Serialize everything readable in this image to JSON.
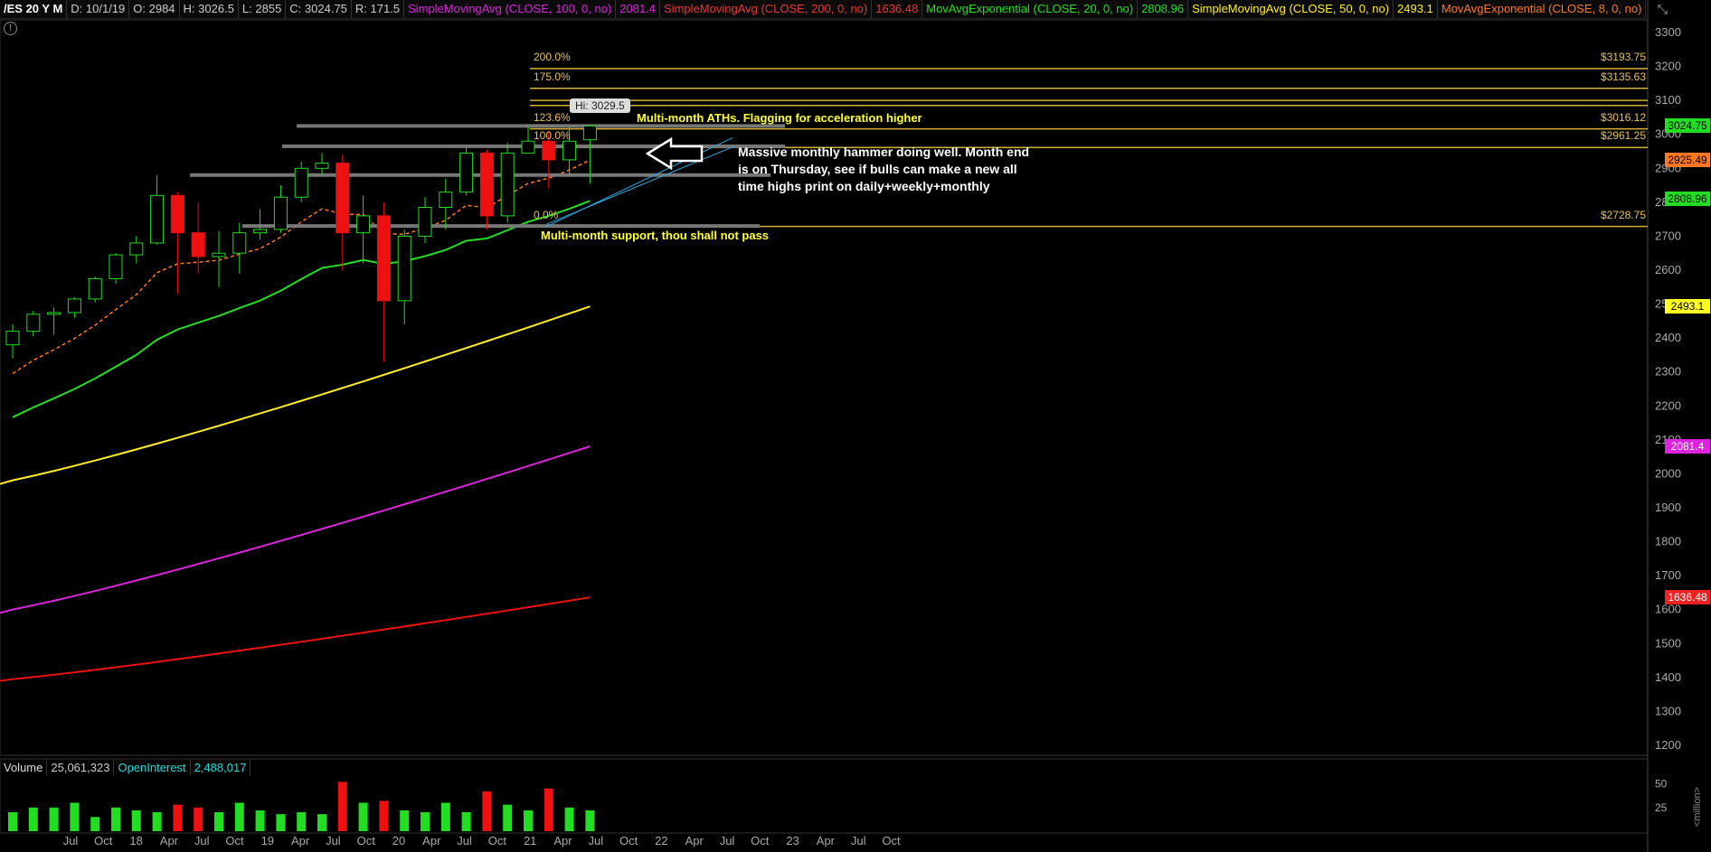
{
  "header": {
    "symbol": "/ES 20 Y M",
    "date": "D: 10/1/19",
    "open": "O: 2984",
    "high": "H: 3026.5",
    "low": "L: 2855",
    "close": "C: 3024.75",
    "range": "R: 171.5",
    "study1": "SimpleMovingAvg (CLOSE, 100, 0, no)",
    "study1_val": "2081.4",
    "study2": "SimpleMovingAvg (CLOSE, 200, 0, no)",
    "study2_val": "1636.48",
    "study3": "MovAvgExponential (CLOSE, 20, 0, no)",
    "study3_val": "2808.96",
    "study4": "SimpleMovingAvg (CLOSE, 50, 0, no)",
    "study4_val": "2493.1",
    "study5": "MovAvgExponential (CLOSE, 8, 0, no)",
    "more": "..."
  },
  "hi_label": "Hi: 3029.5",
  "fib": [
    {
      "pct": "200.0%",
      "price": "$3193.75"
    },
    {
      "pct": "175.0%",
      "price": "$3135.63"
    },
    {
      "pct": "123.6%",
      "price": "$3016.12"
    },
    {
      "pct": "100.0%",
      "price": "$2961.25"
    },
    {
      "pct": "0.0%",
      "price": "$2728.75"
    }
  ],
  "annotations": {
    "ath": "Multi-month ATHs. Flagging for acceleration higher",
    "support": "Multi-month support, thou shall not pass",
    "note_l1": "Massive monthly hammer doing well. Month end",
    "note_l2": "is on Thursday, see if bulls can make a new all",
    "note_l3": "time highs print on daily+weekly+monthly"
  },
  "price_axis": [
    "3300",
    "3200",
    "3100",
    "3000",
    "2900",
    "2800",
    "2700",
    "2600",
    "2500",
    "2400",
    "2300",
    "2200",
    "2100",
    "2000",
    "1900",
    "1800",
    "1700",
    "1600",
    "1500",
    "1400",
    "1300",
    "1200"
  ],
  "tags": [
    {
      "label": "3024.75",
      "color": "#22dd22"
    },
    {
      "label": "2925.49",
      "color": "#ff7722"
    },
    {
      "label": "2808.96",
      "color": "#22dd22"
    },
    {
      "label": "2493.1",
      "color": "#ffff22"
    },
    {
      "label": "2081.4",
      "color": "#dd22dd"
    },
    {
      "label": "1636.48",
      "color": "#ee2222"
    }
  ],
  "volume": {
    "label": "Volume",
    "value": "25,061,323",
    "oi_label": "OpenInterest",
    "oi_value": "2,488,017",
    "axis": [
      "50",
      "25"
    ],
    "unit": "<million>"
  },
  "time_axis": [
    "Jul",
    "Oct",
    "18",
    "Apr",
    "Jul",
    "Oct",
    "19",
    "Apr",
    "Jul",
    "Oct",
    "20",
    "Apr",
    "Jul",
    "Oct",
    "21",
    "Apr",
    "Jul",
    "Oct",
    "22",
    "Apr",
    "Jul",
    "Oct",
    "23",
    "Apr",
    "Jul",
    "Oct"
  ],
  "colors": {
    "up": "#22dd22",
    "down": "#ee1111",
    "ema20": "#22dd22",
    "sma50": "#ffee22",
    "sma100": "#dd22dd",
    "sma200": "#ee1111",
    "ema8": "#ff7722",
    "fib": "#d4b030"
  },
  "chart_data": {
    "type": "candlestick",
    "categories": [
      "2017-06",
      "2017-07",
      "2017-08",
      "2017-09",
      "2017-10",
      "2017-11",
      "2017-12",
      "2018-01",
      "2018-02",
      "2018-03",
      "2018-04",
      "2018-05",
      "2018-06",
      "2018-07",
      "2018-08",
      "2018-09",
      "2018-10",
      "2018-11",
      "2018-12",
      "2019-01",
      "2019-02",
      "2019-03",
      "2019-04",
      "2019-05",
      "2019-06",
      "2019-07",
      "2019-08",
      "2019-09",
      "2019-10"
    ],
    "ohlc": [
      [
        2380,
        2440,
        2340,
        2420
      ],
      [
        2420,
        2480,
        2405,
        2470
      ],
      [
        2470,
        2490,
        2410,
        2475
      ],
      [
        2475,
        2520,
        2460,
        2515
      ],
      [
        2515,
        2580,
        2505,
        2575
      ],
      [
        2575,
        2650,
        2560,
        2645
      ],
      [
        2645,
        2700,
        2620,
        2680
      ],
      [
        2680,
        2880,
        2675,
        2820
      ],
      [
        2820,
        2830,
        2530,
        2710
      ],
      [
        2710,
        2800,
        2590,
        2640
      ],
      [
        2640,
        2715,
        2550,
        2650
      ],
      [
        2650,
        2740,
        2590,
        2710
      ],
      [
        2710,
        2780,
        2690,
        2720
      ],
      [
        2720,
        2850,
        2710,
        2815
      ],
      [
        2815,
        2920,
        2800,
        2900
      ],
      [
        2900,
        2945,
        2880,
        2915
      ],
      [
        2915,
        2940,
        2600,
        2710
      ],
      [
        2710,
        2820,
        2620,
        2760
      ],
      [
        2760,
        2800,
        2330,
        2510
      ],
      [
        2510,
        2720,
        2440,
        2700
      ],
      [
        2700,
        2815,
        2680,
        2785
      ],
      [
        2785,
        2870,
        2720,
        2830
      ],
      [
        2830,
        2960,
        2820,
        2945
      ],
      [
        2945,
        2955,
        2720,
        2760
      ],
      [
        2760,
        2975,
        2740,
        2945
      ],
      [
        2945,
        3025,
        2950,
        2980
      ],
      [
        2980,
        3010,
        2840,
        2925
      ],
      [
        2925,
        3020,
        2880,
        2980
      ],
      [
        2984,
        3026.5,
        2855,
        3024.75
      ]
    ],
    "volume": [
      20,
      25,
      25,
      30,
      15,
      25,
      22,
      20,
      28,
      25,
      20,
      30,
      22,
      18,
      20,
      18,
      52,
      30,
      32,
      22,
      20,
      30,
      20,
      42,
      28,
      22,
      45,
      25,
      22
    ],
    "ylim": [
      1150,
      3350
    ]
  }
}
